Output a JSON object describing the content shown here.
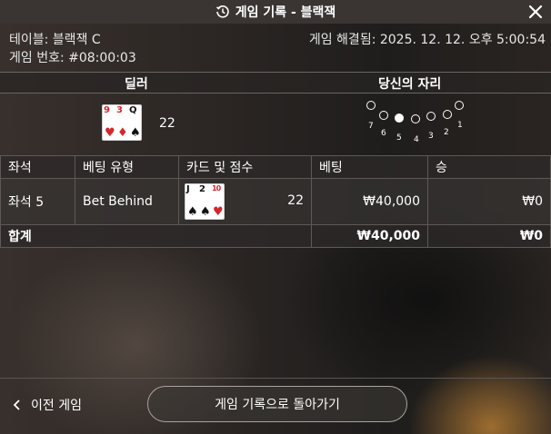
{
  "title": "게임 기록 - 블랙잭",
  "table_label": "테이블: 블랙잭 C",
  "game_id": "게임 번호: #08:00:03",
  "resolved": "게임 해결됨: 2025. 12. 12. 오후 5:00:54",
  "dealer_header": "딜러",
  "seat_header": "당신의 자리",
  "dealer": {
    "cards": [
      {
        "rank": "9",
        "suit": "♥",
        "color": "#d4262c"
      },
      {
        "rank": "3",
        "suit": "♦",
        "color": "#d4262c"
      },
      {
        "rank": "Q",
        "suit": "♠",
        "color": "#111111"
      }
    ],
    "score": "22"
  },
  "seats": {
    "labels": [
      "7",
      "6",
      "5",
      "4",
      "3",
      "2",
      "1"
    ],
    "selected": "5"
  },
  "columns": [
    "좌석",
    "베팅 유형",
    "카드 및 점수",
    "베팅",
    "승"
  ],
  "rows": [
    {
      "seat": "좌석 5",
      "bet_type": "Bet Behind",
      "cards": [
        {
          "rank": "J",
          "suit": "♠",
          "color": "#111111"
        },
        {
          "rank": "2",
          "suit": "♠",
          "color": "#111111"
        },
        {
          "rank": "10",
          "suit": "♥",
          "color": "#d4262c"
        }
      ],
      "score": "22",
      "bet": "₩40,000",
      "win": "₩0"
    }
  ],
  "total": {
    "label": "합계",
    "bet": "₩40,000",
    "win": "₩0"
  },
  "footer": {
    "prev_label": "이전 게임",
    "back_label": "게임 기록으로 돌아가기"
  },
  "icons": {
    "title_icon": "history-icon",
    "close": "close-icon",
    "prev": "chevron-left-icon"
  }
}
